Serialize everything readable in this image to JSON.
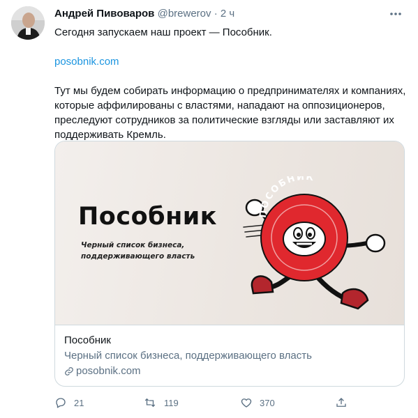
{
  "author": {
    "name": "Андрей Пивоваров",
    "handle": "@brewerov",
    "separator": "·",
    "time": "2 ч"
  },
  "tweet": {
    "line1": "Сегодня запускаем наш проект — Пособник.",
    "link": "posobnik.com",
    "body": "Тут мы будем собирать информацию о предпринимателях и компаниях, которые аффилированы с властями, нападают на оппозиционеров, преследуют сотрудников за политические взгляды или заставляют их поддерживать Кремль."
  },
  "card": {
    "image_title": "Пособник",
    "image_subtitle_line1": "Черный список бизнеса,",
    "image_subtitle_line2": "поддерживающего власть",
    "mascot_text": "ПОСОБНИК",
    "title": "Пособник",
    "description": "Черный список бизнеса, поддерживающего власть",
    "domain": "posobnik.com"
  },
  "actions": {
    "replies": "21",
    "retweets": "119",
    "likes": "370"
  },
  "colors": {
    "link": "#1b95e0",
    "secondary": "#5b7083",
    "mascot_red": "#e0282e",
    "border": "#cfd9de"
  },
  "icons": [
    "more-icon",
    "link-icon",
    "reply-icon",
    "retweet-icon",
    "like-icon",
    "share-icon"
  ]
}
